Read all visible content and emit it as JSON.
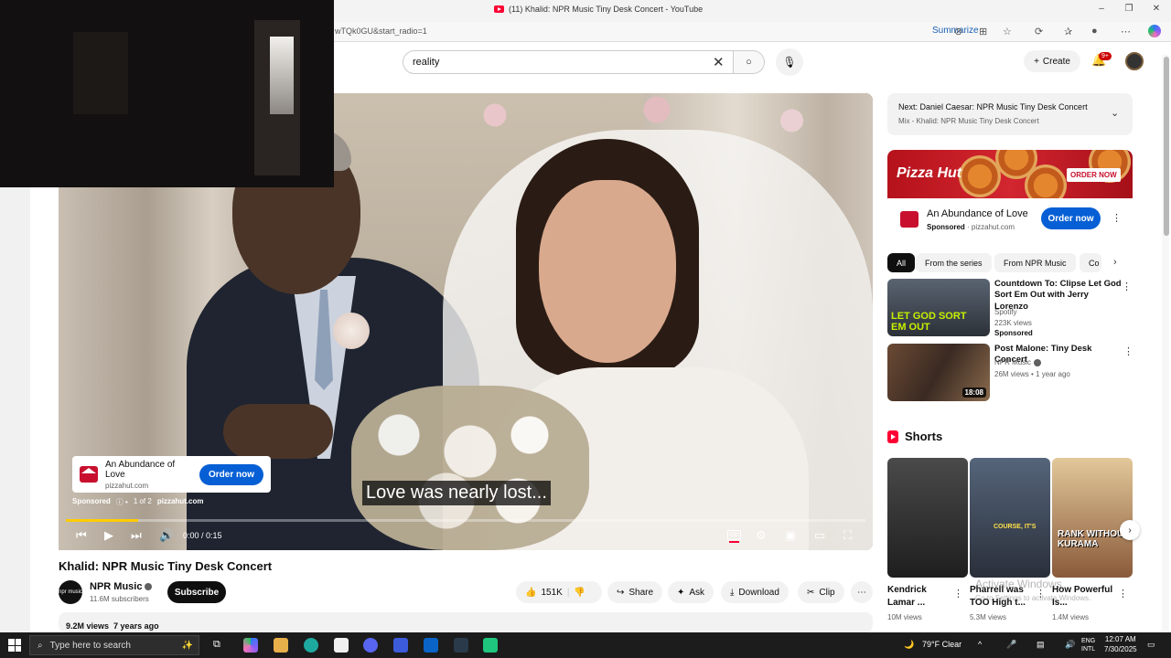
{
  "browser": {
    "tab_title": "(11) Khalid: NPR Music Tiny Desk Concert - YouTube",
    "url": "wTQk0GU&start_radio=1",
    "summarize": "Summarize",
    "window_controls": [
      "–",
      "❐",
      "✕"
    ]
  },
  "header": {
    "search_value": "reality",
    "create_label": "Create",
    "notif_count": "9+"
  },
  "player": {
    "caption": "Love was nearly lost...",
    "ad_title": "An Abundance of Love",
    "ad_domain": "pizzahut.com",
    "ad_cta": "Order now",
    "ad_sponsored": "Sponsored",
    "ad_count": "1 of 2",
    "ad_meta_domain": "pizzahut.com",
    "time": "0:00 / 0:15",
    "progress_fraction": 0.09,
    "cc_label": "CC"
  },
  "video": {
    "title": "Khalid: NPR Music Tiny Desk Concert",
    "channel": "NPR Music",
    "channel_avatar_text": "npr music",
    "subscribers": "11.6M subscribers",
    "subscribe_label": "Subscribe",
    "likes": "151K",
    "share": "Share",
    "ask": "Ask",
    "download": "Download",
    "clip": "Clip",
    "views": "9.2M views",
    "age": "7 years ago"
  },
  "sidebar": {
    "next_title": "Next: Daniel Caesar: NPR Music Tiny Desk Concert",
    "next_sub": "Mix - Khalid: NPR Music Tiny Desk Concert",
    "banner_brand": "Pizza Hut",
    "banner_cta": "ORDER NOW",
    "ad_title": "An Abundance of Love",
    "ad_sponsored": "Sponsored",
    "ad_domain": "pizzahut.com",
    "ad_cta": "Order now",
    "chips": [
      "All",
      "From the series",
      "From NPR Music",
      "Co"
    ],
    "recs": [
      {
        "title": "Countdown To: Clipse Let God Sort Em Out with Jerry Lorenzo",
        "channel": "Spotify",
        "views": "223K views",
        "badge": "Sponsored",
        "thumb_text": "LET GOD SORT EM OUT",
        "duration": ""
      },
      {
        "title": "Post Malone: Tiny Desk Concert",
        "channel": "NPR Music",
        "views": "26M views",
        "age": "1 year ago",
        "duration": "18:08"
      }
    ],
    "shorts_label": "Shorts",
    "shorts": [
      {
        "title": "Kendrick Lamar ...",
        "views": "10M views",
        "overlay": ""
      },
      {
        "title": "Pharrell was TOO High t...",
        "views": "5.3M views",
        "overlay": "COURSE, IT'S"
      },
      {
        "title": "How Powerful Is...",
        "views": "1.4M views",
        "overlay": "RANK WITHOUT KURAMA"
      }
    ],
    "watermark_title": "Activate Windows",
    "watermark_sub": "Go to Settings to activate Windows."
  },
  "taskbar": {
    "search_placeholder": "Type here to search",
    "weather": "79°F  Clear",
    "lang_top": "ENG",
    "lang_bottom": "INTL",
    "time": "12:07 AM",
    "date": "7/30/2025"
  },
  "colors": {
    "youtube_red": "#ff0033",
    "link_blue": "#065fd4",
    "pizzahut_red": "#c8102e",
    "progress_yellow": "#ffcc00"
  }
}
